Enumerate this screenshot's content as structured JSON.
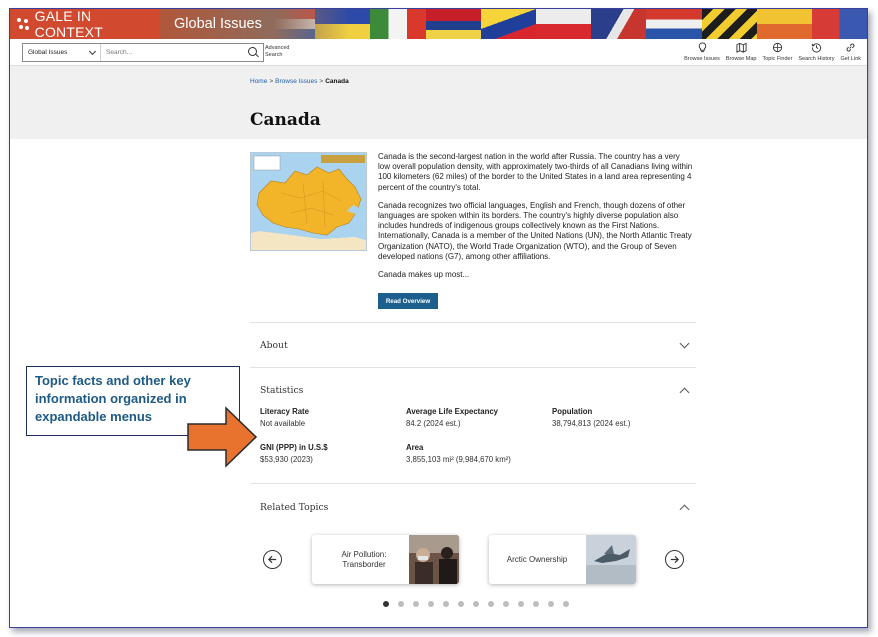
{
  "colors": {
    "brand": "#d14a2f",
    "button": "#1c5f8f",
    "link": "#1f5fa8",
    "callout_text": "#1d5a85",
    "callout_arrow": "#e8732e"
  },
  "banner": {
    "brand_title": "GALE IN CONTEXT",
    "product_title": "Global Issues"
  },
  "toolbar": {
    "scope_select": "Global Issues",
    "search_placeholder": "Search...",
    "advanced_search": "Advanced Search",
    "tools": [
      {
        "label": "Browse Issues",
        "icon": "lightbulb-icon"
      },
      {
        "label": "Browse Map",
        "icon": "map-icon"
      },
      {
        "label": "Topic Finder",
        "icon": "topic-finder-icon"
      },
      {
        "label": "Search History",
        "icon": "history-icon"
      },
      {
        "label": "Get Link",
        "icon": "link-icon"
      }
    ]
  },
  "breadcrumb": {
    "home": "Home",
    "browse": "Browse Issues",
    "separator": ">",
    "current": "Canada"
  },
  "page_title": "Canada",
  "overview": {
    "paragraphs": [
      "Canada is the second-largest nation in the world after Russia. The country has a very low overall population density, with approximately two-thirds of all Canadians living within 100 kilometers (62 miles) of the border to the United States in a land area representing 4 percent of the country's total.",
      "Canada recognizes two official languages, English and French, though dozens of other languages are spoken within its borders. The country's highly diverse population also includes hundreds of indigenous groups collectively known as the First Nations. Internationally, Canada is a member of the United Nations (UN), the North Atlantic Treaty Organization (NATO), the World Trade Organization (WTO), and the Group of Seven developed nations (G7), among other affiliations.",
      "Canada makes up most..."
    ],
    "read_button": "Read Overview"
  },
  "sections": {
    "about": "About",
    "statistics": "Statistics",
    "related": "Related Topics"
  },
  "statistics": [
    {
      "label": "Literacy Rate",
      "value": "Not available"
    },
    {
      "label": "Average Life Expectancy",
      "value": "84.2 (2024 est.)"
    },
    {
      "label": "Population",
      "value": "38,794,813 (2024 est.)"
    },
    {
      "label": "GNI (PPP) in U.S.$",
      "value": "$53,930 (2023)"
    },
    {
      "label": "Area",
      "value": "3,855,103 mi² (9,984,670 km²)"
    }
  ],
  "related_topics": [
    {
      "label": "Air Pollution: Transborder"
    },
    {
      "label": "Arctic Ownership"
    }
  ],
  "carousel": {
    "dot_count": 13,
    "active_index": 0
  },
  "annotation": {
    "text": "Topic facts and other key information organized in expandable menus"
  }
}
